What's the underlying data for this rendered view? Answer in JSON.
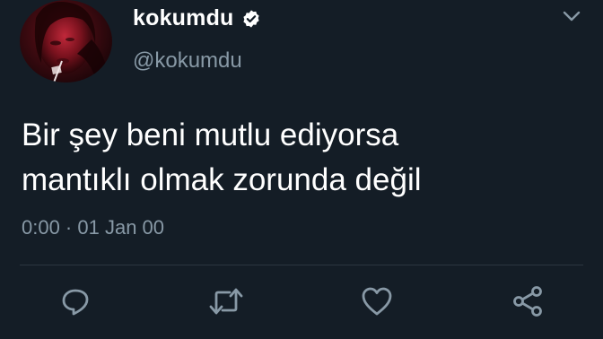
{
  "user": {
    "display_name": "kokumdu",
    "handle": "@kokumdu",
    "verified_icon": "verified-badge-icon"
  },
  "tweet": {
    "lines": [
      "Bir şey beni mutlu ediyorsa",
      "mantıklı olmak zorunda değil"
    ],
    "timestamp": "0:00 · 01 Jan 00"
  },
  "actions": [
    {
      "name": "reply",
      "icon": "reply-icon"
    },
    {
      "name": "retweet",
      "icon": "retweet-icon"
    },
    {
      "name": "like",
      "icon": "heart-icon"
    },
    {
      "name": "share",
      "icon": "share-icon"
    }
  ],
  "colors": {
    "background": "#141d26",
    "primary_text": "#ffffff",
    "secondary_text": "#8899a6",
    "divider": "#2c3640"
  }
}
